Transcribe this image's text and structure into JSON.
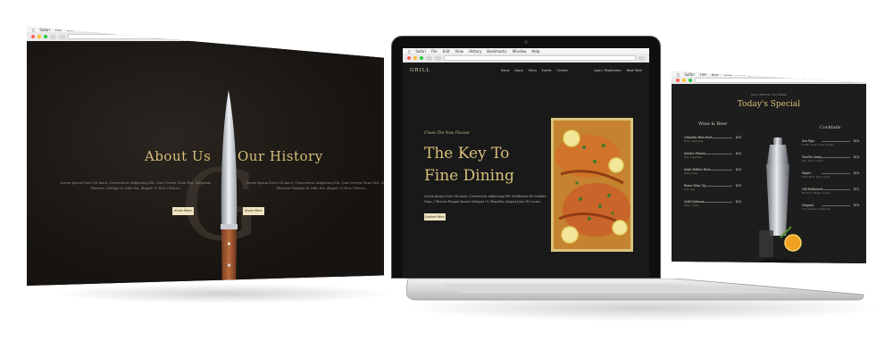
{
  "left_screen": {
    "menubar": [
      "Safari",
      "File",
      "Edit",
      "View",
      "History",
      "Bookmarks",
      "Window",
      "Help"
    ],
    "url": "",
    "monogram": "G",
    "about": {
      "title": "About Us",
      "text": "Lorem Ipsum Dolor Sit Amet, Consectetur Adipiscing Elit. Quis Viverra Vitae Nisl. Vulputate Pharetra Volutpat In Odio Est, Aliquet Ut Eros Ultrices.",
      "button": "Know More"
    },
    "history": {
      "title": "Our History",
      "text": "Lorem Ipsum Dolor Sit Amet, Consectetur Adipiscing Elit. Quis Viverra Vitae Nisl. Vulputate Pharetra Volutpat In Odio Est, Aliquet Ut Eros Ultrices.",
      "button": "Know More"
    }
  },
  "laptop": {
    "menubar": [
      "Safari",
      "File",
      "Edit",
      "View",
      "History",
      "Bookmarks",
      "Window",
      "Help"
    ],
    "url": "",
    "logo": "GRILL",
    "nav": [
      "Home",
      "About",
      "Menu",
      "Events",
      "Contact"
    ],
    "nav_right": [
      "Login / Registration",
      "Book Table"
    ],
    "hero": {
      "eyebrow": "Chase The New Flavour",
      "title": "The Key To Fine Dining",
      "description": "Lorem Ipsum Dolor Sit Amet, Consectetur Adipiscing Elit. Vestibulum Eu Sodales Nunc, Ultricies Feugiat Mauris Volutpat Ut. Phasellus Aliquet Justo Et Luctus.",
      "button": "Explore Menu"
    }
  },
  "right_screen": {
    "menubar": [
      "Safari",
      "File",
      "Edit",
      "View",
      "History",
      "Bookmarks",
      "Window",
      "Help"
    ],
    "url": "",
    "small": "Menu That Fits Your Palate",
    "title": "Today's Special",
    "wine": {
      "heading": "Wine & Beer",
      "items": [
        {
          "name": "Chandon Brut Rosé",
          "price": "$35",
          "desc": "Rosé, California"
        },
        {
          "name": "Sandra Plaines",
          "price": "$20",
          "desc": "Red, Argentina"
        },
        {
          "name": "Saint Hallow Brut",
          "price": "$25",
          "desc": "White, Italy"
        },
        {
          "name": "Roma Wine Up",
          "price": "$30",
          "desc": "Red, Italy"
        },
        {
          "name": "Gold Salmona",
          "price": "$20",
          "desc": "White, Chile"
        }
      ]
    },
    "cocktails": {
      "heading": "Cocktails",
      "items": [
        {
          "name": "Sea Pipe",
          "price": "$16",
          "desc": "Vodka, Lime, Soda, Orange"
        },
        {
          "name": "Teach'n Away",
          "price": "$14",
          "desc": "Gin, Tonic, Lemon"
        },
        {
          "name": "Mojito",
          "price": "$16",
          "desc": "Rum, Mint, Lime, Sugar"
        },
        {
          "name": "Old Fashioned",
          "price": "$15",
          "desc": "Bourbon, Bitters, Sugar"
        },
        {
          "name": "Negroni",
          "price": "$18",
          "desc": "Gin, Campari, Vermouth"
        }
      ]
    }
  },
  "colors": {
    "gold": "#d8bf7a",
    "cream": "#efe3c2",
    "dark": "#1a1714"
  }
}
